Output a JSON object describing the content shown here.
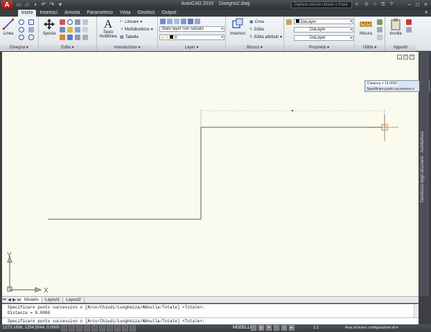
{
  "title_bar": {
    "logo_letter": "A",
    "app_title": "AutoCAD 2010",
    "file_name": "Disegno2.dwg",
    "search_placeholder": "Digitare parola chiave o frase",
    "qat_icons": [
      "new-icon",
      "open-icon",
      "save-icon",
      "undo-icon",
      "redo-icon",
      "plot-icon"
    ],
    "tool_icons": [
      "binoculars-icon",
      "star-icon",
      "key-icon",
      "help-icon"
    ]
  },
  "ribbon_tabs": [
    "Inizio",
    "Inserisci",
    "Annota",
    "Parametrico",
    "Vista",
    "Gestisci",
    "Output"
  ],
  "ribbon_active_tab": "Inizio",
  "ribbon": {
    "disegna": {
      "title": "Disegna ▾",
      "linea": "Linea"
    },
    "edita": {
      "title": "Edita ▾",
      "sposta": "Sposta"
    },
    "annotazione": {
      "title": "Annotazione ▾",
      "testo": "Testo",
      "testo2": "multilinea",
      "lineare": "Lineare",
      "multidirettrice": "Multidirettrice",
      "tabella": "Tabella"
    },
    "layer": {
      "title": "Layer ▾",
      "stato": "Stato layer non salvato",
      "current": "0"
    },
    "blocco": {
      "title": "Blocco ▾",
      "inserisci": "Inserisci",
      "crea": "Crea",
      "edita": "Edita",
      "edita_attributi": "Edita attributi"
    },
    "proprieta": {
      "title": "Proprietà ▾",
      "color": "DaLayer",
      "linetype": "DaLayer",
      "lineweight": "DaLayer"
    },
    "utilita": {
      "title": "Utilità ▾",
      "misura": "Misura"
    },
    "appunti": {
      "title": "Appunti",
      "incolla": "Incolla"
    }
  },
  "palette_label": "Tavolozze degli strumenti · Architettura",
  "ucs": {
    "x": "X",
    "y": "Y"
  },
  "tooltip": {
    "distance": "Distanza = 14.0000",
    "prompt": "Specificare punto successivo o"
  },
  "layout_tabs": [
    "Modello",
    "Layout1",
    "Layout2"
  ],
  "layout_active": "Modello",
  "command_line": [
    "Specificare punto successivo o [Arco/Chiudi/Lunghezza/ANnulla/Totale] <Totale>:",
    "Distanza = 8.0000"
  ],
  "command_prompt": "Specificare punto successivo o [Arco/Chiudi/Lunghezza/ANnulla/Totale] <Totale>:",
  "status": {
    "coords": "1273.1606, 1354.5044, 0.0000",
    "model": "MODELLO",
    "scale": "1:1",
    "workspace": "Area di lavoro: configurazione ini ▾"
  },
  "colors": {
    "canvas": "#fbfaef",
    "polyline": "#5a5a5a",
    "cursor": "#e07a10",
    "ribbon": "#e6eaee",
    "titlebar": "#3e4246"
  }
}
